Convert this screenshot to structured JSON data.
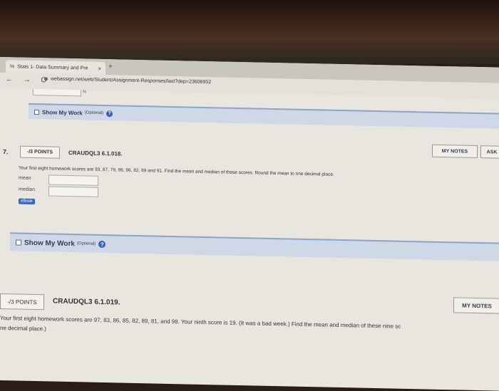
{
  "browser": {
    "tab_title": "Stats 1- Data Summary and Pre",
    "tab_close": "×",
    "new_tab": "+",
    "nav_icons": "← → C",
    "url": "webassign.net/web/Student/Assignment-Responses/last?dep=23606952"
  },
  "prev_question": {
    "percent_symbol": "%",
    "show_work_label": "Show My Work",
    "show_work_optional": "(Optional)"
  },
  "question7": {
    "number": "7.",
    "points": "-/3 POINTS",
    "code": "CRAUDQL3 6.1.018.",
    "my_notes": "MY NOTES",
    "ask": "ASK",
    "prompt_prefix": "Your first eight homework scores are ",
    "scores": "93, 87, 79, 86, 96, 82, 89",
    "and": " and ",
    "last_score": "91",
    "prompt_suffix": ". Find the mean and median of these scores. Round the mean to one decimal place.",
    "mean_label": "mean",
    "median_label": "median",
    "ebook": "eBook",
    "show_work_label": "Show My Work",
    "show_work_optional": "(Optional)"
  },
  "question8": {
    "points": "-/3 POINTS",
    "code": "CRAUDQL3 6.1.019.",
    "my_notes": "MY NOTES",
    "prompt_line1_prefix": "Your first eight homework scores are ",
    "scores": "97, 83, 86, 85, 82, 89, 81, and 98",
    "mid": ". Your ninth score is ",
    "ninth": "19",
    "prompt_line1_suffix": ". (It was a bad week.) Find the mean and median of these nine sc",
    "prompt_line2": "ne decimal place.)"
  }
}
